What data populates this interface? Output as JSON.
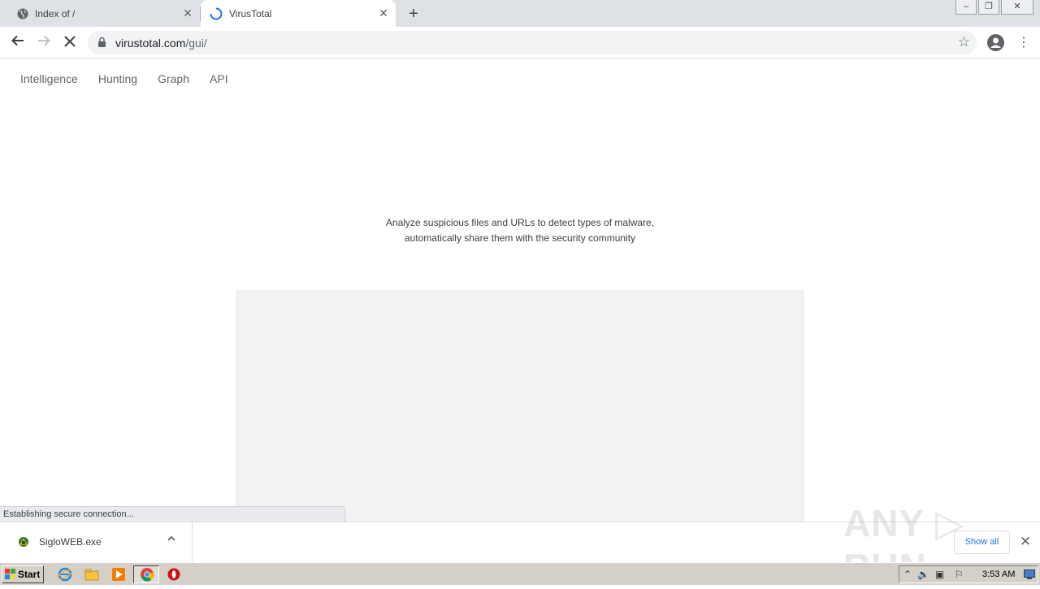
{
  "browser": {
    "tabs": [
      {
        "title": "Index of /",
        "active": false
      },
      {
        "title": "VirusTotal",
        "active": true
      }
    ],
    "address": {
      "domain": "virustotal.com",
      "path": "/gui/"
    }
  },
  "site": {
    "nav": [
      "Intelligence",
      "Hunting",
      "Graph",
      "API"
    ],
    "tagline_line1": "Analyze suspicious files and URLs to detect types of malware,",
    "tagline_line2": "automatically share them with the security community"
  },
  "status_bubble": "Establishing secure connection...",
  "download_shelf": {
    "item_name": "SigloWEB.exe",
    "show_all_label": "Show all"
  },
  "taskbar": {
    "start_label": "Start",
    "clock": "3:53 AM"
  },
  "colors": {
    "tab_strip": "#dee1e6",
    "omnibox": "#f1f3f4",
    "link_blue": "#1a73e8",
    "taskbar": "#d4d0c8",
    "loading_spinner": "#1a73e8"
  }
}
